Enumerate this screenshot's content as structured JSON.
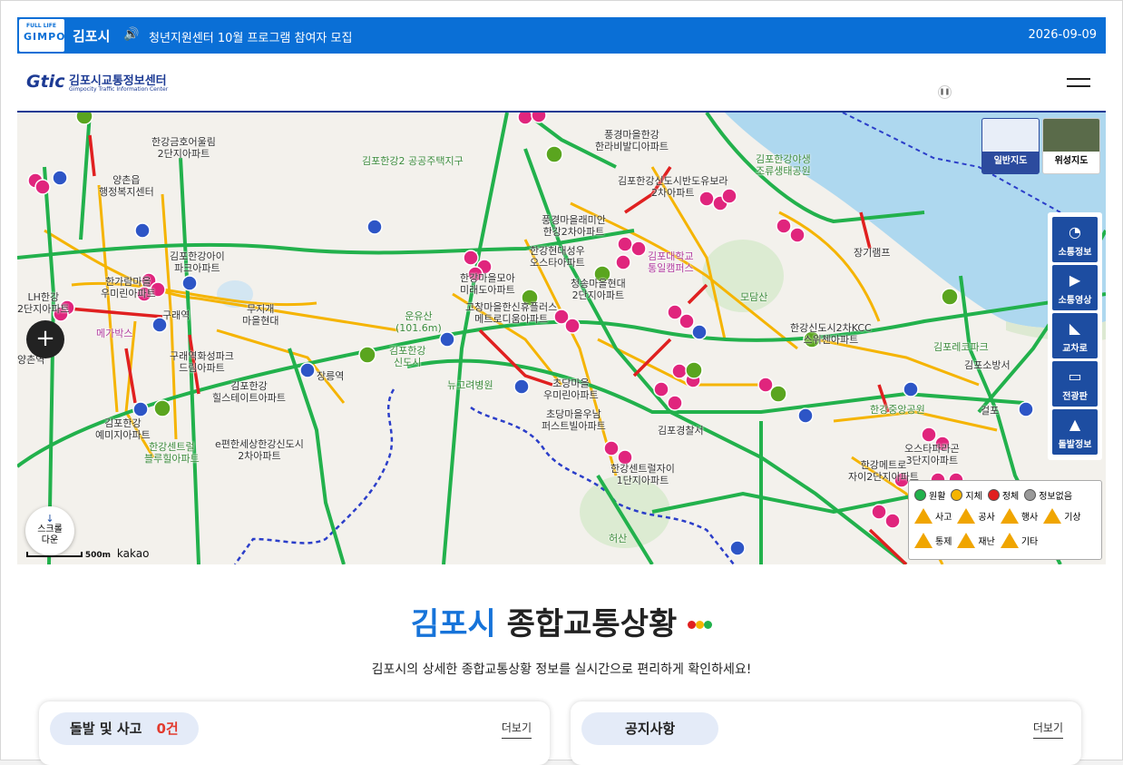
{
  "topbar": {
    "logo_small": "FULL LIFE",
    "logo_big": "GIMPO",
    "city": "김포시",
    "notice": "청년지원센터 10월 프로그램 참여자 모집",
    "date": "2026-09-09"
  },
  "header": {
    "brand_mark": "Gtic",
    "brand_ko": "김포시교통정보센터",
    "brand_en": "Gimpocity Traffic Information Center"
  },
  "map": {
    "maptypes": [
      "일반지도",
      "위성지도"
    ],
    "side_buttons": [
      "소통정보",
      "소통영상",
      "교차로",
      "전광판",
      "돌발정보"
    ],
    "scroll_label": "스크롤 다운",
    "scale": "500m",
    "provider": "kakao",
    "legend_status": [
      "원활",
      "지체",
      "정체",
      "정보없음"
    ],
    "legend_status_colors": [
      "#22b14c",
      "#f5b400",
      "#e02020",
      "#999999"
    ],
    "legend_events_row1": [
      "사고",
      "공사",
      "행사",
      "기상"
    ],
    "legend_events_row2": [
      "통제",
      "재난",
      "기타"
    ],
    "places": [
      {
        "t": "한강금호어울림\n2단지아파트"
      },
      {
        "t": "양촌읍\n행정복지센터"
      },
      {
        "t": "김포한강2 공공주택지구"
      },
      {
        "t": "풍경마을한강\n한라비발디아파트"
      },
      {
        "t": "김포한강야생\n조류생태공원"
      },
      {
        "t": "김포한강신도시반도유보라\n2차아파트"
      },
      {
        "t": "풍경마을래미안\n한강2차아파트"
      },
      {
        "t": "김포한강아이\n파크아파트"
      },
      {
        "t": "한강현대성우\n오스타아파트"
      },
      {
        "t": "김포대학교\n통일캠퍼스"
      },
      {
        "t": "한가람마을\n우미린아파트"
      },
      {
        "t": "한강마을모아\n미래도아파트"
      },
      {
        "t": "청송마을현대\n2단지아파트"
      },
      {
        "t": "모담산"
      },
      {
        "t": "무지개\n마을현대"
      },
      {
        "t": "운유산\n(101.6m)"
      },
      {
        "t": "고창마을한신휴플러스\n메트로디움아파트"
      },
      {
        "t": "메가박스"
      },
      {
        "t": "구래역화성파크\n드림아파트"
      },
      {
        "t": "김포한강\n신도시"
      },
      {
        "t": "뉴고려병원"
      },
      {
        "t": "초당마을\n우미린아파트"
      },
      {
        "t": "김포한강\n힐스테이트아파트"
      },
      {
        "t": "초당마을우남\n퍼스트빌아파트"
      },
      {
        "t": "김포경찰서"
      },
      {
        "t": "김포한강\n예미지아파트"
      },
      {
        "t": "한강센트럴\n블루힐아파트"
      },
      {
        "t": "e편한세상한강신도시\n2차아파트"
      },
      {
        "t": "한강센트럴자이\n1단지아파트"
      },
      {
        "t": "허산"
      },
      {
        "t": "김포레코파크"
      },
      {
        "t": "김포소방서"
      },
      {
        "t": "한강중앙공원"
      },
      {
        "t": "오스타파라곤\n3단지아파트"
      },
      {
        "t": "한강메트로\n자이2단지아파트"
      },
      {
        "t": "LH한강\n2단지아파트"
      },
      {
        "t": "양촌역"
      },
      {
        "t": "구래역"
      },
      {
        "t": "장릉역"
      },
      {
        "t": "걸포"
      },
      {
        "t": "한강신도시2차KCC\n스위첸아파트"
      },
      {
        "t": "장기램프"
      },
      {
        "t": "한강중앙공원"
      }
    ]
  },
  "main": {
    "title_blue": "김포시",
    "title_rest": "종합교통상황",
    "subtitle": "김포시의 상세한 종합교통상황 정보를 실시간으로 편리하게 확인하세요!"
  },
  "cards": [
    {
      "label": "돌발 및 사고",
      "count": "0건",
      "more": "더보기"
    },
    {
      "label": "공지사항",
      "more": "더보기"
    }
  ]
}
